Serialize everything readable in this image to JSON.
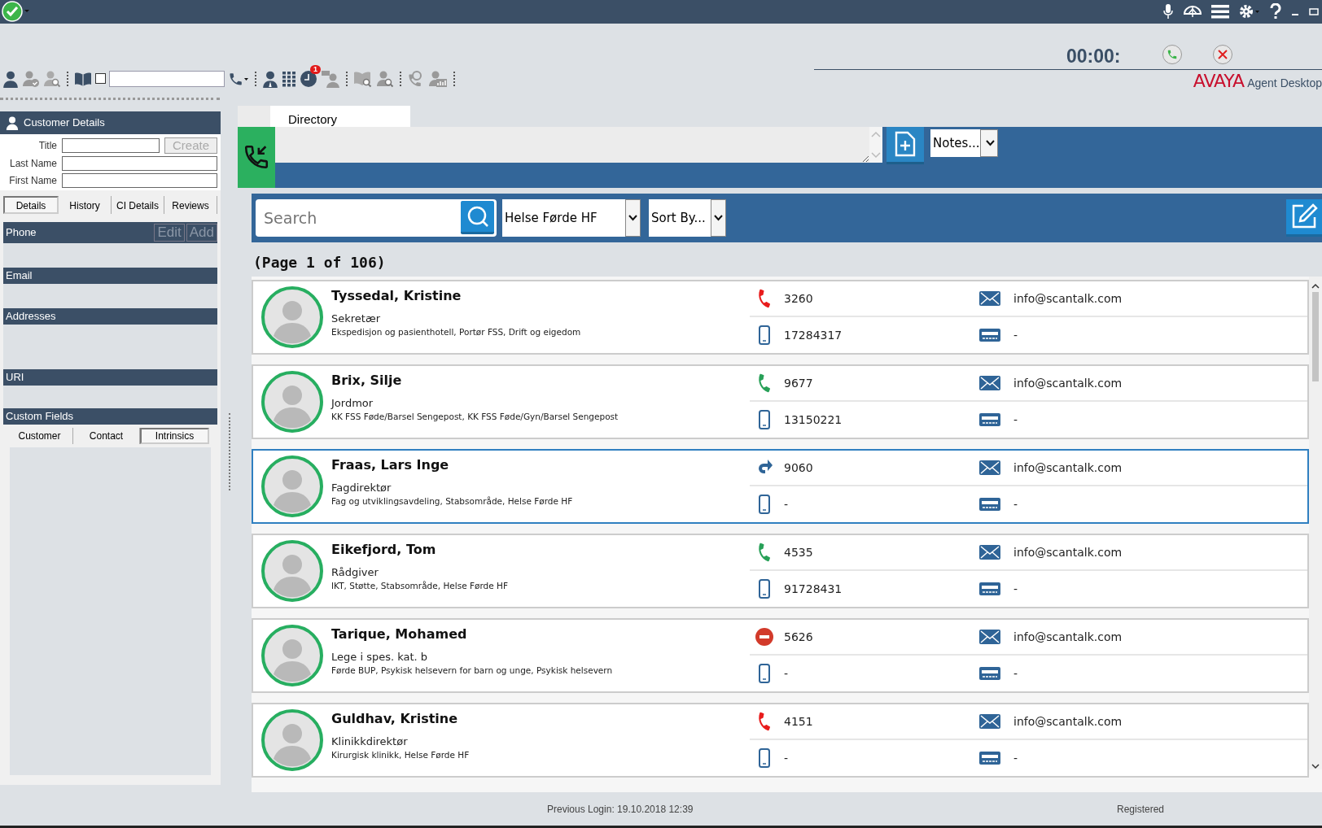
{
  "header": {
    "toolbar_checkbox": {
      "checked": false
    },
    "toolbar_badge": "1",
    "timer": "00:00:",
    "logo": "AVAYA",
    "product": "Agent Desktop"
  },
  "customer_details": {
    "title": "Customer Details",
    "fields": [
      {
        "label": "Title"
      },
      {
        "label": "Last Name"
      },
      {
        "label": "First Name"
      }
    ],
    "create_button": {
      "label": "Create",
      "disabled": true
    },
    "tabs": [
      {
        "label": "Details",
        "selected": true
      },
      {
        "label": "History",
        "selected": false
      },
      {
        "label": "CI Details",
        "selected": false
      },
      {
        "label": "Reviews",
        "selected": false
      }
    ],
    "sections": [
      {
        "title": "Phone",
        "buttons": [
          {
            "label": "Edit",
            "disabled": true
          },
          {
            "label": "Add",
            "disabled": true
          }
        ]
      },
      {
        "title": "Email"
      },
      {
        "title": "Addresses"
      },
      {
        "title": "URI"
      },
      {
        "title": "Custom Fields"
      }
    ],
    "custom_tabs": [
      {
        "label": "Customer",
        "selected": false
      },
      {
        "label": "Contact",
        "selected": false
      },
      {
        "label": "Intrinsics",
        "selected": true
      }
    ]
  },
  "directory": {
    "tab": "Directory",
    "notes_select": "Notes...",
    "search": {
      "placeholder": "Search"
    },
    "group_select": "Helse Førde HF",
    "sort_select": "Sort By...",
    "page": "(Page 1 of 106)",
    "contacts": [
      {
        "name": "Tyssedal, Kristine",
        "role": "Sekretær",
        "department": "Ekspedisjon og pasienthotell, Portør FSS, Drift og eigedom",
        "extension": {
          "kind": "busy",
          "number": "3260"
        },
        "mobile": "17284317",
        "email": "info@scantalk.com",
        "pager": "-",
        "selected": false
      },
      {
        "name": "Brix, Silje",
        "role": "Jordmor",
        "department": "KK FSS Føde/Barsel Sengepost, KK FSS Føde/Gyn/Barsel Sengepost",
        "extension": {
          "kind": "available",
          "number": "9677"
        },
        "mobile": "13150221",
        "email": "info@scantalk.com",
        "pager": "-",
        "selected": false
      },
      {
        "name": "Fraas, Lars Inge",
        "role": "Fagdirektør",
        "department": "Fag og utviklingsavdeling, Stabsområde, Helse Førde HF",
        "extension": {
          "kind": "forwarded",
          "number": "9060"
        },
        "mobile": "-",
        "email": "info@scantalk.com",
        "pager": "-",
        "selected": true
      },
      {
        "name": "Eikefjord, Tom",
        "role": "Rådgiver",
        "department": "IKT, Støtte, Stabsområde, Helse Førde HF",
        "extension": {
          "kind": "available",
          "number": "4535"
        },
        "mobile": "91728431",
        "email": "info@scantalk.com",
        "pager": "-",
        "selected": false
      },
      {
        "name": "Tarique, Mohamed",
        "role": "Lege i spes. kat. b",
        "department": "Førde BUP, Psykisk helsevern for barn og unge, Psykisk helsevern",
        "extension": {
          "kind": "dnd",
          "number": "5626"
        },
        "mobile": "-",
        "email": "info@scantalk.com",
        "pager": "-",
        "selected": false
      },
      {
        "name": "Guldhav, Kristine",
        "role": "Klinikkdirektør",
        "department": "Kirurgisk klinikk, Helse Førde HF",
        "extension": {
          "kind": "busy",
          "number": "4151"
        },
        "mobile": "-",
        "email": "info@scantalk.com",
        "pager": "-",
        "selected": false
      }
    ]
  },
  "status_bar": {
    "previous_login": "Previous Login: 19.10.2018 12:39",
    "registration": "Registered"
  }
}
